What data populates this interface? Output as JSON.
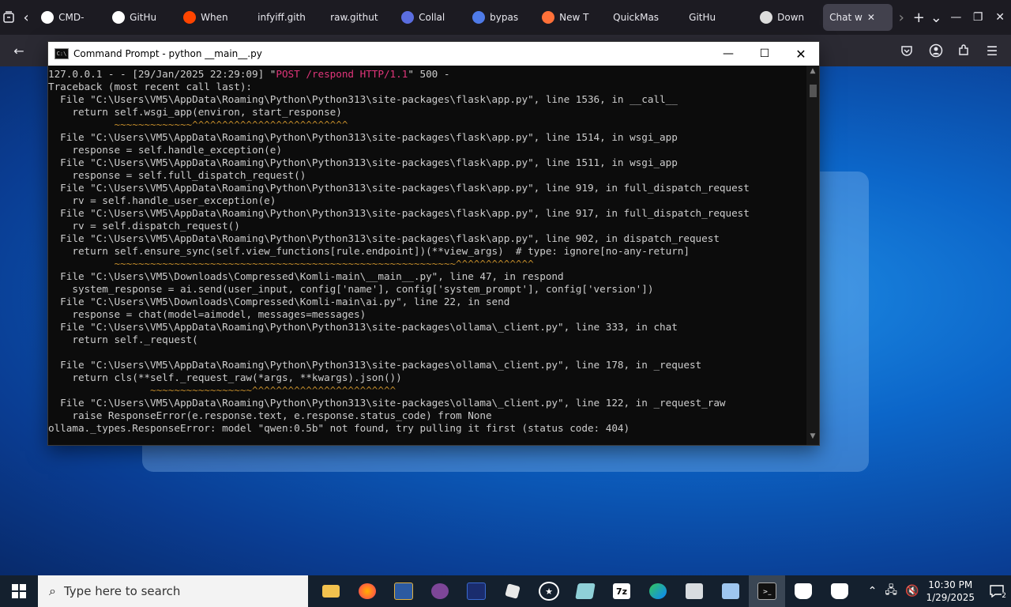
{
  "browser": {
    "tabs": [
      {
        "label": "CMD-",
        "icon": "github-icon"
      },
      {
        "label": "GitHu",
        "icon": "github-icon"
      },
      {
        "label": "When",
        "icon": "reddit-icon"
      },
      {
        "label": "infyiff.gith",
        "icon": ""
      },
      {
        "label": "raw.githut",
        "icon": ""
      },
      {
        "label": "Collal",
        "icon": "search-icon"
      },
      {
        "label": "bypas",
        "icon": "doc-icon"
      },
      {
        "label": "New T",
        "icon": "firefox-icon"
      },
      {
        "label": "QuickMas",
        "icon": ""
      },
      {
        "label": "GitHu",
        "icon": ""
      },
      {
        "label": "Down",
        "icon": "globe-icon"
      },
      {
        "label": "Chat w",
        "icon": "",
        "active": true
      }
    ]
  },
  "cmd": {
    "title": "Command Prompt - python  __main__.py",
    "icon_text": "C:\\",
    "lines": [
      {
        "t": "127.0.0.1 - - [29/Jan/2025 22:29:09] \"",
        "h": "POST /respond HTTP/1.1",
        "a": "\" 500 -"
      },
      {
        "t": "Traceback (most recent call last):"
      },
      {
        "t": "  File \"C:\\Users\\VM5\\AppData\\Roaming\\Python\\Python313\\site-packages\\flask\\app.py\", line 1536, in __call__"
      },
      {
        "t": "    return self.wsgi_app(environ, start_response)"
      },
      {
        "w": "           ~~~~~~~~~~~~~^^^^^^^^^^^^^^^^^^^^^^^^^^"
      },
      {
        "t": "  File \"C:\\Users\\VM5\\AppData\\Roaming\\Python\\Python313\\site-packages\\flask\\app.py\", line 1514, in wsgi_app"
      },
      {
        "t": "    response = self.handle_exception(e)"
      },
      {
        "t": "  File \"C:\\Users\\VM5\\AppData\\Roaming\\Python\\Python313\\site-packages\\flask\\app.py\", line 1511, in wsgi_app"
      },
      {
        "t": "    response = self.full_dispatch_request()"
      },
      {
        "t": "  File \"C:\\Users\\VM5\\AppData\\Roaming\\Python\\Python313\\site-packages\\flask\\app.py\", line 919, in full_dispatch_request"
      },
      {
        "t": "    rv = self.handle_user_exception(e)"
      },
      {
        "t": "  File \"C:\\Users\\VM5\\AppData\\Roaming\\Python\\Python313\\site-packages\\flask\\app.py\", line 917, in full_dispatch_request"
      },
      {
        "t": "    rv = self.dispatch_request()"
      },
      {
        "t": "  File \"C:\\Users\\VM5\\AppData\\Roaming\\Python\\Python313\\site-packages\\flask\\app.py\", line 902, in dispatch_request"
      },
      {
        "t": "    return self.ensure_sync(self.view_functions[rule.endpoint])(**view_args)  # type: ignore[no-any-return]"
      },
      {
        "w": "           ~~~~~~~~~~~~~~~~~~~~~~~~~~~~~~~~~~~~~~~~~~~~~~~~~~~~~~~~~^^^^^^^^^^^^^"
      },
      {
        "t": "  File \"C:\\Users\\VM5\\Downloads\\Compressed\\Komli-main\\__main__.py\", line 47, in respond"
      },
      {
        "t": "    system_response = ai.send(user_input, config['name'], config['system_prompt'], config['version'])"
      },
      {
        "t": "  File \"C:\\Users\\VM5\\Downloads\\Compressed\\Komli-main\\ai.py\", line 22, in send"
      },
      {
        "t": "    response = chat(model=aimodel, messages=messages)"
      },
      {
        "t": "  File \"C:\\Users\\VM5\\AppData\\Roaming\\Python\\Python313\\site-packages\\ollama\\_client.py\", line 333, in chat"
      },
      {
        "t": "    return self._request("
      },
      {
        "t": ""
      },
      {
        "t": "  File \"C:\\Users\\VM5\\AppData\\Roaming\\Python\\Python313\\site-packages\\ollama\\_client.py\", line 178, in _request"
      },
      {
        "t": "    return cls(**self._request_raw(*args, **kwargs).json())"
      },
      {
        "w": "                 ~~~~~~~~~~~~~~~~~^^^^^^^^^^^^^^^^^^^^^^^^"
      },
      {
        "t": "  File \"C:\\Users\\VM5\\AppData\\Roaming\\Python\\Python313\\site-packages\\ollama\\_client.py\", line 122, in _request_raw"
      },
      {
        "t": "    raise ResponseError(e.response.text, e.response.status_code) from None"
      },
      {
        "t": "ollama._types.ResponseError: model \"qwen:0.5b\" not found, try pulling it first (status code: 404)"
      }
    ]
  },
  "taskbar": {
    "search_placeholder": "Type here to search",
    "apps": [
      "file-explorer-icon",
      "firefox-icon",
      "photo-app-icon",
      "tor-browser-icon",
      "vs-code-icon",
      "roblox-icon",
      "settings-app-icon",
      "notepad-icon",
      "7zip-icon",
      "edge-icon",
      "explorer-icon",
      "network-app-icon",
      "command-prompt-icon",
      "app-icon-a",
      "app-icon-b"
    ],
    "time": "10:30 PM",
    "date": "1/29/2025",
    "notification_count": "2"
  }
}
